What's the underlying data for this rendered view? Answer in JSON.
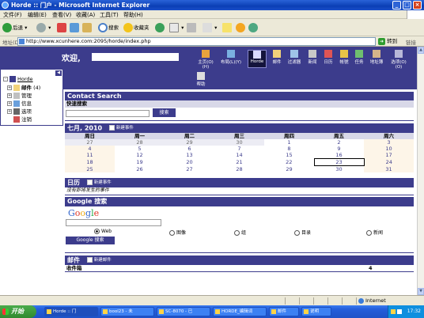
{
  "window": {
    "title": "Horde :: 门户 - Microsoft Internet Explorer"
  },
  "menubar": [
    "文件(F)",
    "编辑(E)",
    "查看(V)",
    "收藏(A)",
    "工具(T)",
    "帮助(H)"
  ],
  "toolbar": {
    "back": "后退",
    "search": "搜索",
    "favorites": "收藏夹"
  },
  "address": {
    "label": "地址(D)",
    "url": "http://www.xcunhere.com:2095/horde/index.php",
    "go": "转到",
    "links": "链接"
  },
  "horde": {
    "welcome": "欢迎,",
    "nav": [
      {
        "label": "主页(O)(H)"
      },
      {
        "label": "布局(L)(Y)"
      },
      {
        "label": "Horde"
      },
      {
        "label": "邮件"
      },
      {
        "label": "过滤器"
      },
      {
        "label": "新闻"
      },
      {
        "label": "日历"
      },
      {
        "label": "帐號"
      },
      {
        "label": "任务"
      },
      {
        "label": "地址簿"
      },
      {
        "label": "选项(O)(O)"
      }
    ],
    "help": "帮助"
  },
  "sidebar": {
    "collapse": "◀",
    "items": [
      {
        "label": "Horde"
      },
      {
        "label": "邮件",
        "count": "(4)"
      },
      {
        "label": "管理"
      },
      {
        "label": "信息"
      },
      {
        "label": "选项"
      },
      {
        "label": "注销"
      }
    ]
  },
  "contact_search": {
    "title": "Contact Search",
    "subtitle": "快速搜索",
    "button": "搜索"
  },
  "calendar": {
    "title": "七月, 2010",
    "new_event": "新建事件",
    "weekdays": [
      "周日",
      "周一",
      "周二",
      "周三",
      "周四",
      "周五",
      "周六"
    ],
    "weeks": [
      [
        "27",
        "28",
        "29",
        "30",
        "1",
        "2",
        "3"
      ],
      [
        "4",
        "5",
        "6",
        "7",
        "8",
        "9",
        "10"
      ],
      [
        "11",
        "12",
        "13",
        "14",
        "15",
        "16",
        "17"
      ],
      [
        "18",
        "19",
        "20",
        "21",
        "22",
        "23",
        "24"
      ],
      [
        "25",
        "26",
        "27",
        "28",
        "29",
        "30",
        "31"
      ]
    ]
  },
  "agenda": {
    "title": "日历",
    "new_event": "新建事件",
    "empty": "没有即将发生的事件"
  },
  "google": {
    "title": "Google 搜索",
    "logo": "Google",
    "options": [
      "Web",
      "图像",
      "组",
      "目录",
      "新闻"
    ],
    "button": "Google 搜索"
  },
  "mail": {
    "title": "邮件",
    "new": "新建邮件",
    "inbox": "收件箱",
    "inbox_count": "4"
  },
  "statusbar": {
    "zone": "Internet"
  },
  "taskbar": {
    "start": "开始",
    "tasks": [
      "Horde :: 门",
      "bool23 - 未",
      "SC-8070 - 已",
      "HORDE_编辑词",
      "邮件",
      "说明"
    ],
    "clock": "17:32"
  }
}
